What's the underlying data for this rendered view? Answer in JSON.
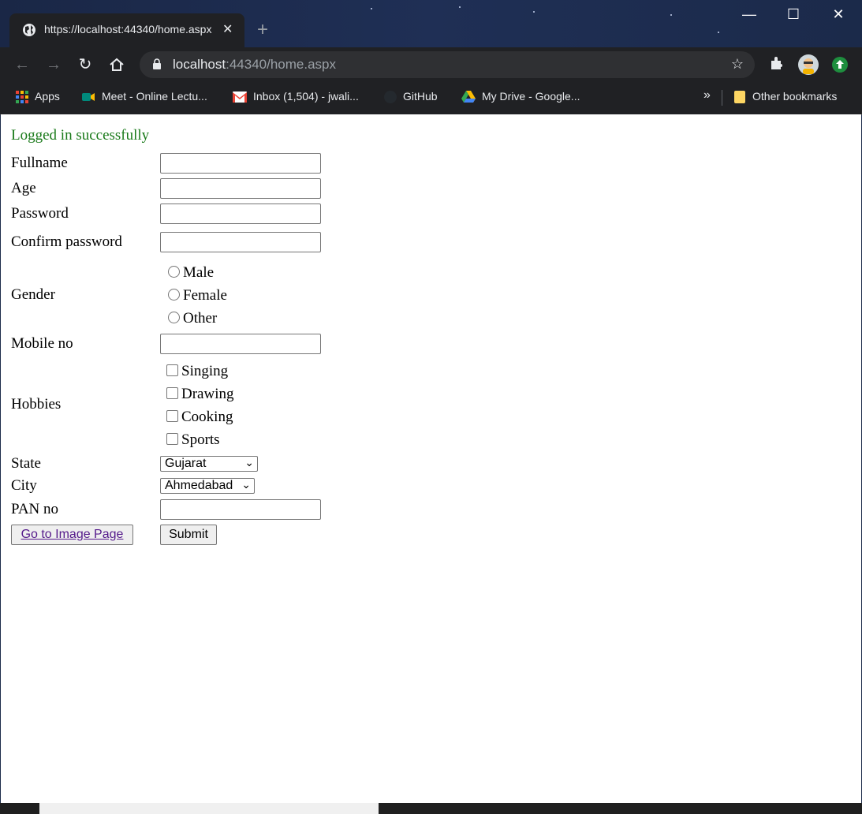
{
  "browser": {
    "tab_title": "https://localhost:44340/home.aspx",
    "url_host": "localhost",
    "url_rest": ":44340/home.aspx",
    "tab_close": "✕",
    "new_tab": "+"
  },
  "window_controls": {
    "minimize": "—",
    "maximize": "☐",
    "close": "✕"
  },
  "bookmarks": {
    "items": [
      {
        "label": "Apps",
        "icon": "apps-grid-icon"
      },
      {
        "label": "Meet - Online Lectu...",
        "icon": "meet-icon"
      },
      {
        "label": "Inbox (1,504) - jwali...",
        "icon": "gmail-icon"
      },
      {
        "label": "GitHub",
        "icon": "github-icon"
      },
      {
        "label": "My Drive - Google...",
        "icon": "drive-icon"
      }
    ],
    "overflow": "»",
    "other": "Other bookmarks"
  },
  "form": {
    "message": "Logged in successfully",
    "fullname_label": "Fullname",
    "age_label": "Age",
    "password_label": "Password",
    "confirm_label": "Confirm password",
    "gender_label": "Gender",
    "gender_options": [
      "Male",
      "Female",
      "Other"
    ],
    "mobile_label": "Mobile no",
    "hobbies_label": "Hobbies",
    "hobby_options": [
      "Singing",
      "Drawing",
      "Cooking",
      "Sports"
    ],
    "state_label": "State",
    "state_value": "Gujarat",
    "city_label": "City",
    "city_value": "Ahmedabad",
    "pan_label": "PAN no",
    "image_link": "Go to Image Page",
    "submit": "Submit"
  }
}
